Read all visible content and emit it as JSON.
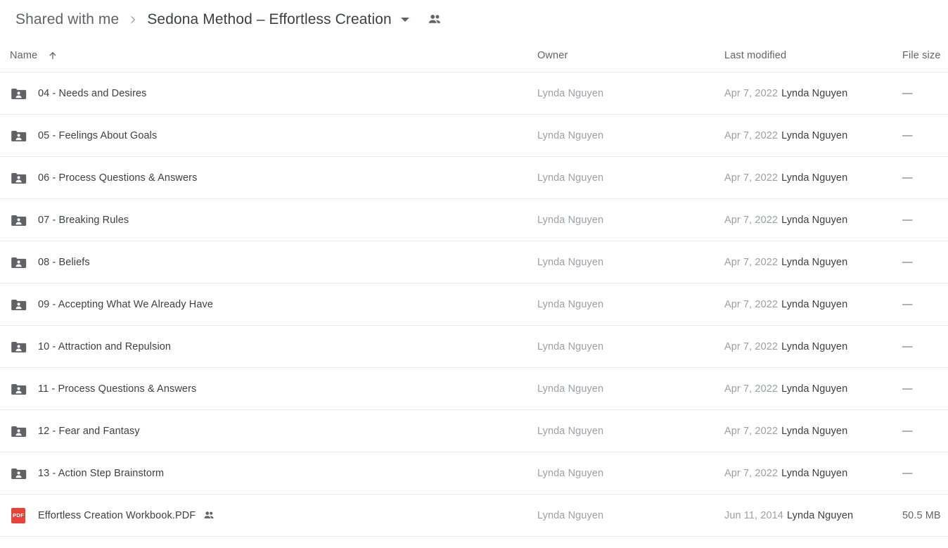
{
  "breadcrumb": {
    "parent": "Shared with me",
    "separator": "›",
    "current": "Sedona Method – Effortless Creation",
    "caret_icon": "chevron-down-icon",
    "people_icon": "people-shared-icon"
  },
  "table": {
    "columns": {
      "name": "Name",
      "owner": "Owner",
      "modified": "Last modified",
      "size": "File size"
    },
    "sort": {
      "column": "Name",
      "direction": "ascending",
      "icon": "arrow-up-icon"
    },
    "rows": [
      {
        "icon": "shared-folder-icon",
        "name": "04 - Needs and Desires",
        "shared": false,
        "owner": "Lynda Nguyen",
        "modified_date": "Apr 7, 2022",
        "modified_by": "Lynda Nguyen",
        "size": "—"
      },
      {
        "icon": "shared-folder-icon",
        "name": "05 - Feelings About Goals",
        "shared": false,
        "owner": "Lynda Nguyen",
        "modified_date": "Apr 7, 2022",
        "modified_by": "Lynda Nguyen",
        "size": "—"
      },
      {
        "icon": "shared-folder-icon",
        "name": "06 - Process Questions & Answers",
        "shared": false,
        "owner": "Lynda Nguyen",
        "modified_date": "Apr 7, 2022",
        "modified_by": "Lynda Nguyen",
        "size": "—"
      },
      {
        "icon": "shared-folder-icon",
        "name": "07 - Breaking Rules",
        "shared": false,
        "owner": "Lynda Nguyen",
        "modified_date": "Apr 7, 2022",
        "modified_by": "Lynda Nguyen",
        "size": "—"
      },
      {
        "icon": "shared-folder-icon",
        "name": "08 - Beliefs",
        "shared": false,
        "owner": "Lynda Nguyen",
        "modified_date": "Apr 7, 2022",
        "modified_by": "Lynda Nguyen",
        "size": "—"
      },
      {
        "icon": "shared-folder-icon",
        "name": "09 - Accepting What We Already Have",
        "shared": false,
        "owner": "Lynda Nguyen",
        "modified_date": "Apr 7, 2022",
        "modified_by": "Lynda Nguyen",
        "size": "—"
      },
      {
        "icon": "shared-folder-icon",
        "name": "10 - Attraction and Repulsion",
        "shared": false,
        "owner": "Lynda Nguyen",
        "modified_date": "Apr 7, 2022",
        "modified_by": "Lynda Nguyen",
        "size": "—"
      },
      {
        "icon": "shared-folder-icon",
        "name": "11 - Process Questions & Answers",
        "shared": false,
        "owner": "Lynda Nguyen",
        "modified_date": "Apr 7, 2022",
        "modified_by": "Lynda Nguyen",
        "size": "—"
      },
      {
        "icon": "shared-folder-icon",
        "name": "12 - Fear and Fantasy",
        "shared": false,
        "owner": "Lynda Nguyen",
        "modified_date": "Apr 7, 2022",
        "modified_by": "Lynda Nguyen",
        "size": "—"
      },
      {
        "icon": "shared-folder-icon",
        "name": "13 - Action Step Brainstorm",
        "shared": false,
        "owner": "Lynda Nguyen",
        "modified_date": "Apr 7, 2022",
        "modified_by": "Lynda Nguyen",
        "size": "—"
      },
      {
        "icon": "pdf-file-icon",
        "icon_label": "PDF",
        "name": "Effortless Creation Workbook.PDF",
        "shared": true,
        "owner": "Lynda Nguyen",
        "modified_date": "Jun 11, 2014",
        "modified_by": "Lynda Nguyen",
        "size": "50.5 MB"
      }
    ]
  },
  "colors": {
    "folder_icon": "#5f6368",
    "pdf_accent": "#ea4335",
    "row_divider": "#e8eaed",
    "primary_text": "#3c4043",
    "secondary_text": "#9aa0a6"
  }
}
